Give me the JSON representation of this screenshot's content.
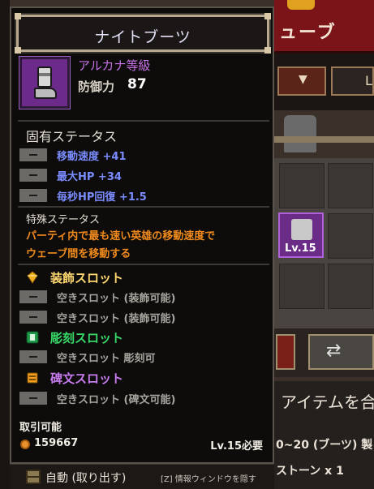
{
  "item": {
    "name": "ナイトブーツ",
    "rarity": "アルカナ等級",
    "defense_label": "防御力",
    "defense_value": "87"
  },
  "inherent": {
    "title": "固有ステータス",
    "stats": [
      {
        "text": "移動速度 +41"
      },
      {
        "text": "最大HP +34"
      },
      {
        "text": "毎秒HP回復 +1.5"
      }
    ]
  },
  "special": {
    "title": "特殊ステータス",
    "lines": [
      "パーティ内で最も速い英雄の移動速度で",
      "ウェーブ間を移動する"
    ]
  },
  "slots": {
    "decoration": {
      "title": "装飾スロット",
      "color": "#ffd870",
      "items": [
        "空きスロット (装飾可能)",
        "空きスロット (装飾可能)"
      ]
    },
    "engraving": {
      "title": "彫刻スロット",
      "color": "#38d868",
      "items": [
        "空きスロット 彫刻可"
      ]
    },
    "rune": {
      "title": "碑文スロット",
      "color": "#c97cf0",
      "items": [
        "空きスロット (碑文可能)"
      ]
    }
  },
  "footer": {
    "trade": "取引可能",
    "gold": "159667",
    "required_level": "Lv.15必要"
  },
  "bottom_bar": {
    "left": "自動 (取り出す)",
    "right": "[Z] 情報ウィンドウを隠す"
  },
  "background": {
    "tab_title": "ューブ",
    "item_level": "Lv.15",
    "text_1": "アイテムを合",
    "text_2": "0~20 (ブーツ) 製",
    "text_3": "ストーン x 1"
  }
}
